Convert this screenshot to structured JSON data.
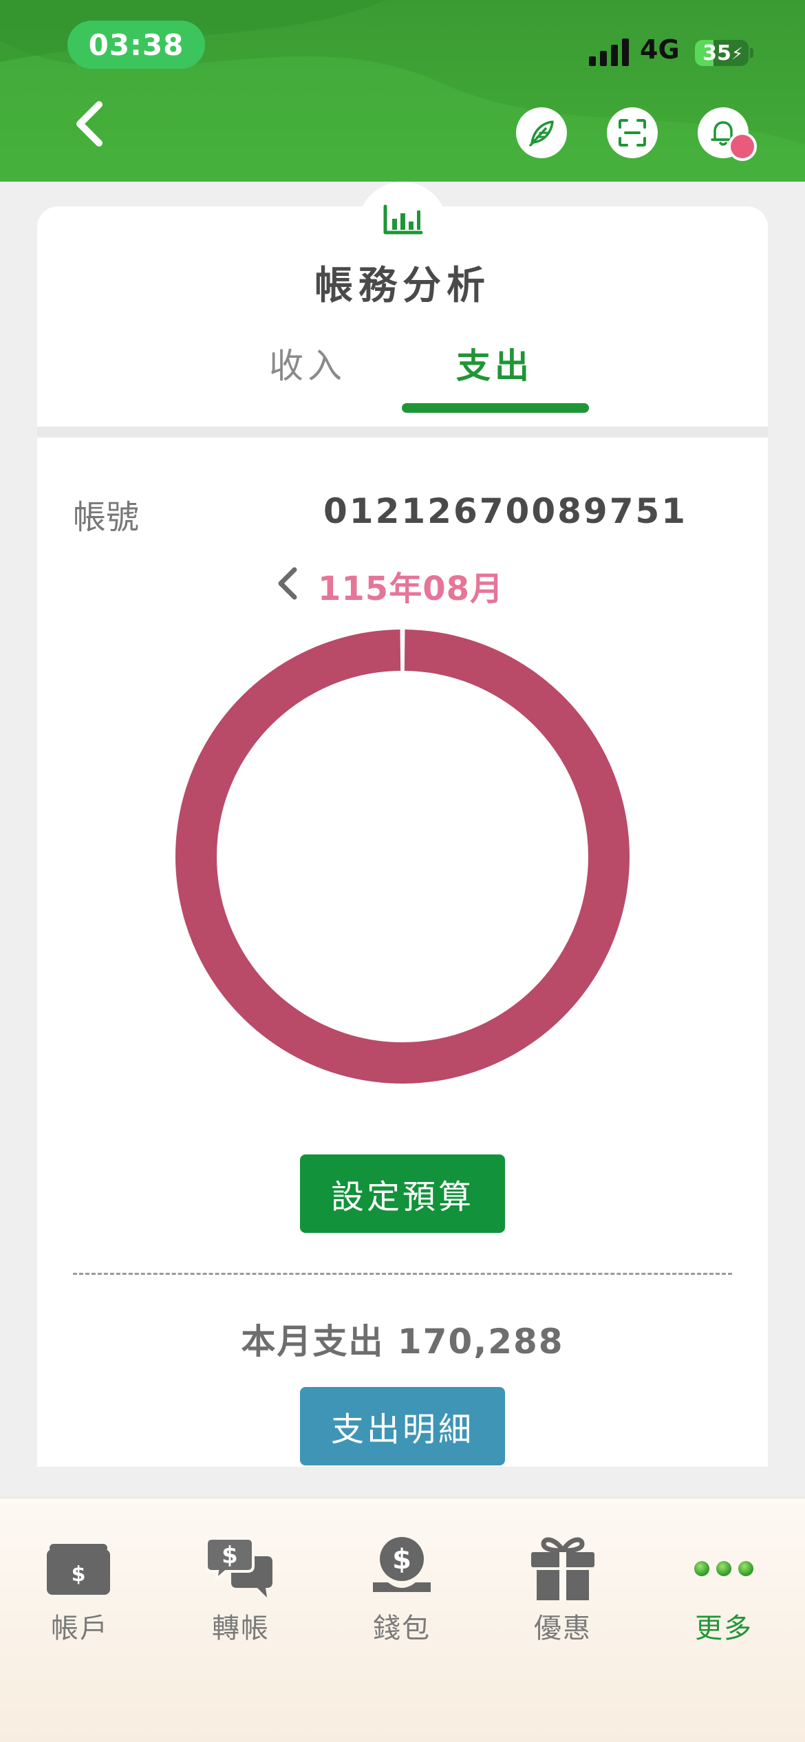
{
  "status_bar": {
    "time": "03:38",
    "network": "4G",
    "battery": "35",
    "battery_level": 0.35
  },
  "header": {
    "back_icon": "chevron-left-icon",
    "actions": [
      {
        "name": "leaf-icon"
      },
      {
        "name": "scan-icon"
      },
      {
        "name": "bell-icon"
      }
    ]
  },
  "page": {
    "title": "帳務分析",
    "title_icon": "bar-chart-icon",
    "tabs": [
      {
        "label": "收入",
        "active": false
      },
      {
        "label": "支出",
        "active": true
      }
    ]
  },
  "account": {
    "label": "帳號",
    "number": "01212670089751"
  },
  "period": {
    "label": "115年08月",
    "prev_icon": "chevron-left-icon"
  },
  "chart_data": {
    "type": "pie",
    "categories": [
      ""
    ],
    "values": [
      100
    ],
    "colors": [
      "#b94a68"
    ]
  },
  "actions": {
    "budget_label": "設定預算",
    "detail_label": "支出明細"
  },
  "summary": {
    "text": "本月支出 170,288"
  },
  "bottom_nav": {
    "items": [
      {
        "label": "帳戶",
        "icon": "wallet-icon",
        "active": false
      },
      {
        "label": "轉帳",
        "icon": "chat-dollar-icon",
        "active": false
      },
      {
        "label": "錢包",
        "icon": "coin-hand-icon",
        "active": false
      },
      {
        "label": "優惠",
        "icon": "gift-icon",
        "active": false
      },
      {
        "label": "更多",
        "icon": "more-dots-icon",
        "active": true
      }
    ]
  },
  "colors": {
    "brand_green": "#1f9636",
    "header_green": "#3fa536",
    "accent_pink": "#e67598",
    "donut": "#b94a68",
    "detail_blue": "#3f95b6"
  }
}
